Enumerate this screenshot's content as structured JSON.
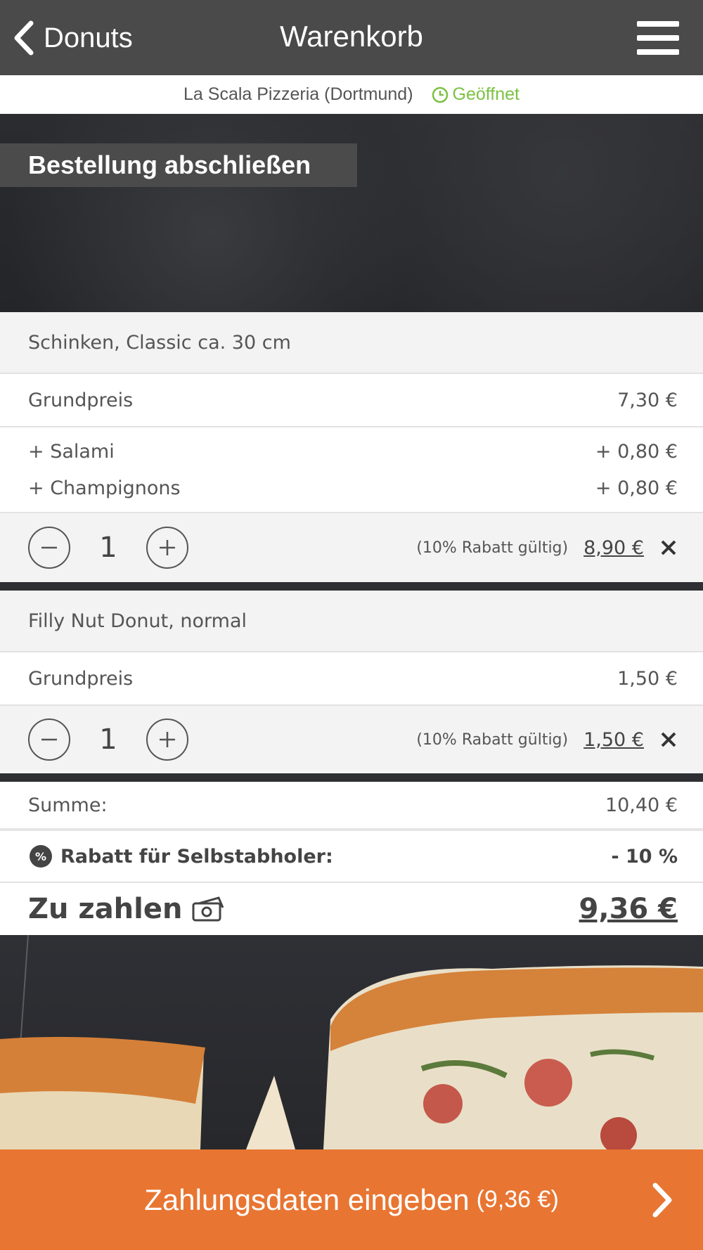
{
  "header": {
    "back_label": "Donuts",
    "title": "Warenkorb"
  },
  "store": {
    "name": "La Scala Pizzeria (Dortmund)",
    "status": "Geöffnet",
    "status_color": "#7cc242"
  },
  "hero": {
    "heading": "Bestellung abschließen"
  },
  "items": [
    {
      "name": "Schinken, Classic ca. 30 cm",
      "base_label": "Grundpreis",
      "base_price": "7,30 €",
      "extras": [
        {
          "label": "+ Salami",
          "price": "+ 0,80 €"
        },
        {
          "label": "+ Champignons",
          "price": "+ 0,80 €"
        }
      ],
      "quantity": "1",
      "discount_note": "(10% Rabatt gültig)",
      "total": "8,90 €"
    },
    {
      "name": "Filly Nut Donut, normal",
      "base_label": "Grundpreis",
      "base_price": "1,50 €",
      "quantity": "1",
      "discount_note": "(10% Rabatt gültig)",
      "total": "1,50 €"
    }
  ],
  "summary": {
    "sum_label": "Summe:",
    "sum_value": "10,40 €",
    "discount_label": "Rabatt für Selbstabholer:",
    "discount_value": "- 10 %",
    "pay_label": "Zu zahlen",
    "pay_value": "9,36 €"
  },
  "cta": {
    "label": "Zahlungsdaten eingeben",
    "amount": "(9,36 €)",
    "color": "#e87532"
  },
  "icons": [
    "chevron-left-icon",
    "hamburger-menu-icon",
    "clock-icon",
    "minus-icon",
    "plus-icon",
    "close-icon",
    "percent-icon",
    "money-icon",
    "chevron-right-icon"
  ]
}
